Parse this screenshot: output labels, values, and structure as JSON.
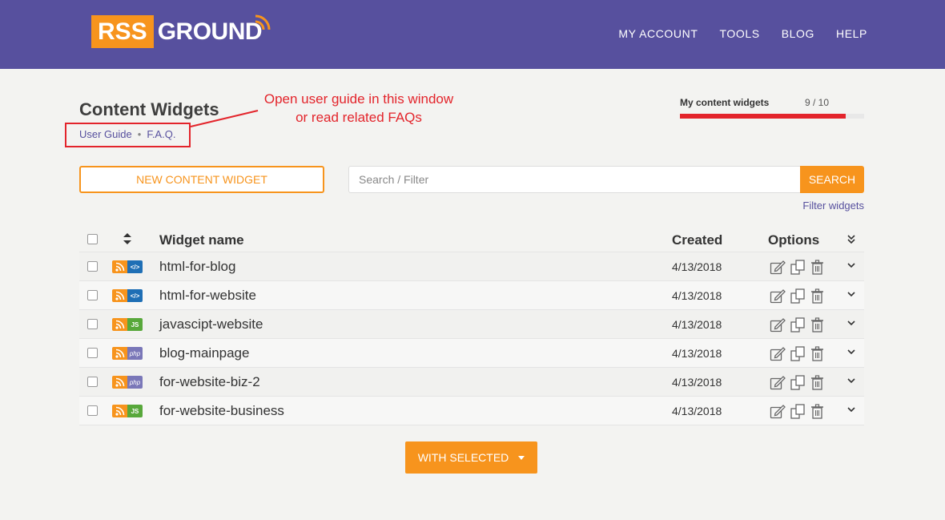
{
  "header": {
    "logo_left": "RSS",
    "logo_right": "GROUND",
    "nav": [
      "MY ACCOUNT",
      "TOOLS",
      "BLOG",
      "HELP"
    ]
  },
  "page": {
    "title": "Content Widgets",
    "user_guide": "User Guide",
    "separator": "•",
    "faq": "F.A.Q.",
    "annotation_line1": "Open user guide in this window",
    "annotation_line2": "or read related FAQs"
  },
  "quota": {
    "label": "My content widgets",
    "value": "9 / 10",
    "used": 9,
    "limit": 10
  },
  "toolbar": {
    "new_label": "NEW CONTENT WIDGET",
    "search_placeholder": "Search / Filter",
    "search_label": "SEARCH",
    "filter_link": "Filter widgets"
  },
  "table": {
    "headers": {
      "name": "Widget name",
      "created": "Created",
      "options": "Options"
    },
    "rows": [
      {
        "name": "html-for-blog",
        "created": "4/13/2018",
        "type": "html"
      },
      {
        "name": "html-for-website",
        "created": "4/13/2018",
        "type": "html"
      },
      {
        "name": "javascipt-website",
        "created": "4/13/2018",
        "type": "js"
      },
      {
        "name": "blog-mainpage",
        "created": "4/13/2018",
        "type": "php"
      },
      {
        "name": "for-website-biz-2",
        "created": "4/13/2018",
        "type": "php"
      },
      {
        "name": "for-website-business",
        "created": "4/13/2018",
        "type": "js"
      }
    ]
  },
  "footer": {
    "with_selected_label": "WITH SELECTED"
  },
  "colors": {
    "brand": "#57509e",
    "accent": "#f7941d",
    "highlight": "#e3242b"
  }
}
